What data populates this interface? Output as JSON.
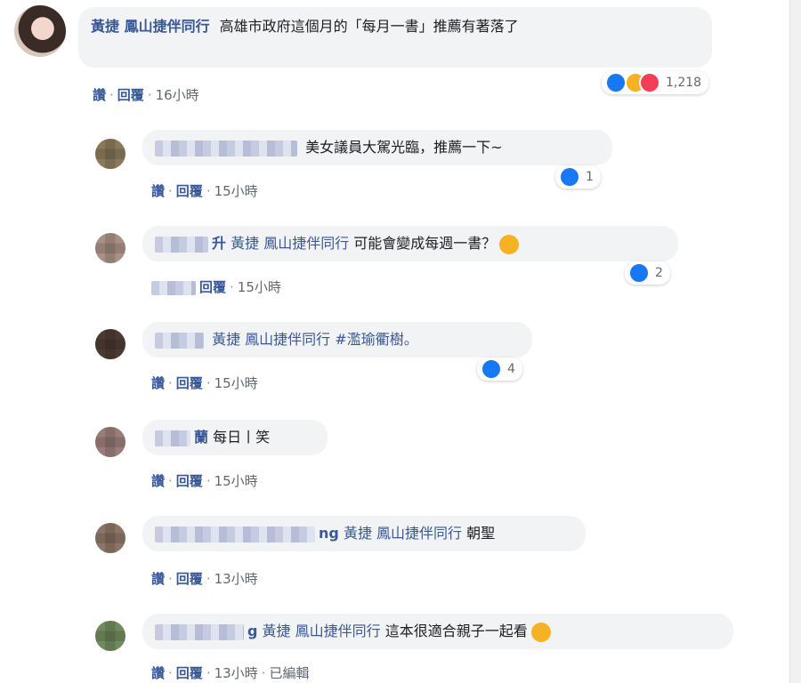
{
  "post_comment": {
    "author": "黃捷 鳳山捷伴同行",
    "text": "高雄市政府這個月的「每月一書」推薦有著落了",
    "reaction_count": "1,218",
    "actions": {
      "like": "讚",
      "reply": "回覆",
      "time": "16小時"
    }
  },
  "replies": [
    {
      "name_suffix": "",
      "mention": "",
      "text": "美女議員大駕光臨，推薦一下~",
      "reactions": "1",
      "like": "讚",
      "reply": "回覆",
      "time": "15小時",
      "edited": ""
    },
    {
      "name_suffix": "升",
      "mention": "黃捷 鳳山捷伴同行",
      "text": "可能會變成每週一書？",
      "reactions": "2",
      "like": "",
      "reply": "回覆",
      "time": "15小時",
      "edited": ""
    },
    {
      "name_suffix": "",
      "mention": "黃捷 鳳山捷伴同行",
      "text": "#濫瑜衢樹。",
      "reactions": "4",
      "like": "讚",
      "reply": "回覆",
      "time": "15小時",
      "edited": ""
    },
    {
      "name_suffix": "蘭",
      "mention": "",
      "text": "每日丨笑",
      "reactions": "",
      "like": "讚",
      "reply": "回覆",
      "time": "15小時",
      "edited": ""
    },
    {
      "name_suffix": "ng",
      "mention": "黃捷 鳳山捷伴同行",
      "text": "朝聖",
      "reactions": "",
      "like": "讚",
      "reply": "回覆",
      "time": "13小時",
      "edited": ""
    },
    {
      "name_suffix": "g",
      "mention": "黃捷 鳳山捷伴同行",
      "text": "這本很適合親子一起看",
      "reactions": "",
      "like": "讚",
      "reply": "回覆",
      "time": "13小時",
      "edited": "已編輯"
    }
  ],
  "colors": {
    "link": "#385898",
    "bubble": "#f2f3f5",
    "like": "#1877f2"
  }
}
